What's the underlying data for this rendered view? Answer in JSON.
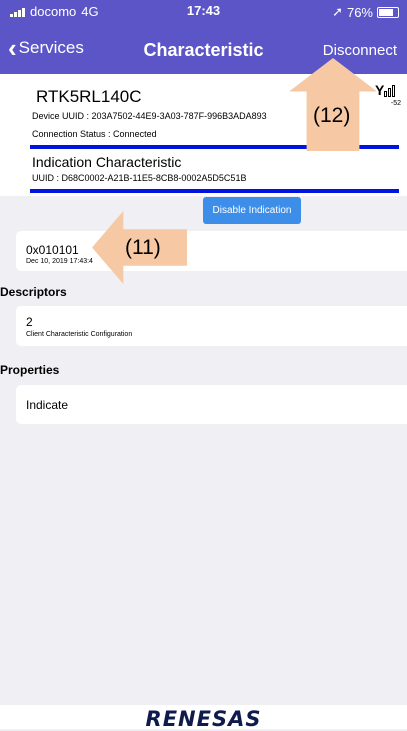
{
  "status_bar": {
    "carrier": "docomo",
    "network": "4G",
    "time": "17:43",
    "battery": "76%"
  },
  "nav": {
    "back_label": "Services",
    "title": "Characteristic",
    "disconnect_label": "Disconnect"
  },
  "device": {
    "name": "RTK5RL140C",
    "uuid": "Device UUID : 203A7502-44E9-3A03-787F-996B3ADA893",
    "connection_status": "Connection Status :   Connected",
    "rssi": "-52"
  },
  "characteristic": {
    "name": "Indication Characteristic",
    "uuid": "UUID : D68C0002-A21B-11E5-8CB8-0002A5D5C51B"
  },
  "disable_button_label": "Disable Indication",
  "value": {
    "value": "0x010101",
    "timestamp": "Dec 10, 2019 17:43:4"
  },
  "descriptors": {
    "header": "Descriptors",
    "value": "2",
    "name": "Client Characteristic Configuration"
  },
  "properties": {
    "header": "Properties",
    "value": "Indicate"
  },
  "annotations": {
    "a12": "(12)",
    "a11": "(11)"
  },
  "footer": {
    "logo": "RENESAS"
  },
  "colors": {
    "nav_bg": "#5b55c8",
    "accent_line": "#0013e0",
    "button": "#3d8ee8",
    "arrow": "#f6c9a4"
  }
}
